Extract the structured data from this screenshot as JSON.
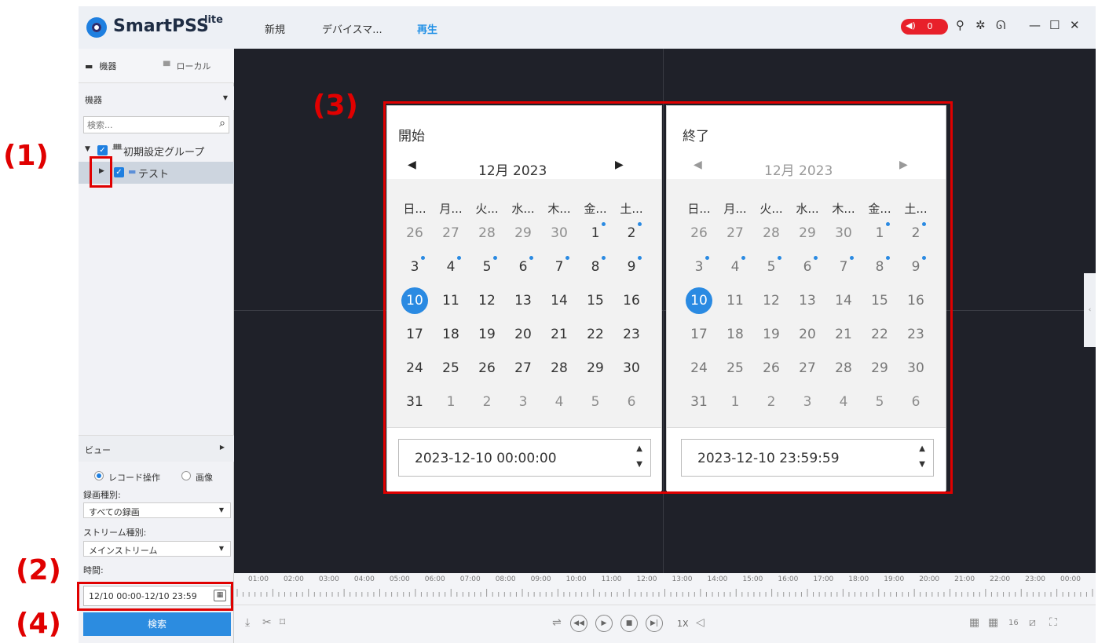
{
  "app": {
    "brand": "SmartPSS",
    "brand_sup": "lite",
    "tabs": [
      "新規",
      "デバイスマ...",
      "再生"
    ],
    "active_tab": "再生",
    "alarm_count": "0",
    "accent_color": "#1e7fe0",
    "alarm_color": "#e8202a",
    "titlebar_icons": [
      "speaker-icon",
      "user-icon",
      "gear-icon",
      "gauge-icon",
      "minimize-icon",
      "maximize-icon",
      "close-icon"
    ]
  },
  "sidebar": {
    "tab_devices": "機器",
    "tab_local": "ローカル",
    "device_filter": "機器",
    "search_placeholder": "検索...",
    "tree_group": "初期設定グループ",
    "tree_device": "テスト",
    "view_label": "ビュー",
    "radio_record": "レコード操作",
    "radio_image": "画像",
    "record_type_label": "録画種別:",
    "record_type_value": "すべての録画",
    "stream_type_label": "ストリーム種別:",
    "stream_type_value": "メインストリーム",
    "time_label": "時間:",
    "time_value": "12/10 00:00-12/10 23:59",
    "search_button": "検索"
  },
  "calendar": {
    "start": {
      "title": "開始",
      "month": "12月",
      "year": "2023",
      "datetime": "2023-12-10 00:00:00"
    },
    "end": {
      "title": "終了",
      "month": "12月",
      "year": "2023",
      "datetime": "2023-12-10 23:59:59"
    },
    "weekdays": [
      "日...",
      "月...",
      "火...",
      "水...",
      "木...",
      "金...",
      "土..."
    ],
    "weeks": [
      [
        "26",
        "27",
        "28",
        "29",
        "30",
        "1",
        "2"
      ],
      [
        "3",
        "4",
        "5",
        "6",
        "7",
        "8",
        "9"
      ],
      [
        "10",
        "11",
        "12",
        "13",
        "14",
        "15",
        "16"
      ],
      [
        "17",
        "18",
        "19",
        "20",
        "21",
        "22",
        "23"
      ],
      [
        "24",
        "25",
        "26",
        "27",
        "28",
        "29",
        "30"
      ],
      [
        "31",
        "1",
        "2",
        "3",
        "4",
        "5",
        "6"
      ]
    ],
    "selected_day": "10",
    "days_with_records": [
      "1",
      "2",
      "3",
      "4",
      "5",
      "6",
      "7",
      "8",
      "9",
      "10"
    ]
  },
  "timeline": {
    "hours": [
      "01:00",
      "02:00",
      "03:00",
      "04:00",
      "05:00",
      "06:00",
      "07:00",
      "08:00",
      "09:00",
      "10:00",
      "11:00",
      "12:00",
      "13:00",
      "14:00",
      "15:00",
      "16:00",
      "17:00",
      "18:00",
      "19:00",
      "20:00",
      "21:00",
      "22:00",
      "23:00",
      "00:00"
    ]
  },
  "controls": {
    "speed": "1X"
  },
  "annotations": {
    "a1": "(1)",
    "a2": "(2)",
    "a3": "(3)",
    "a4": "(4)",
    "color": "#e00000"
  }
}
